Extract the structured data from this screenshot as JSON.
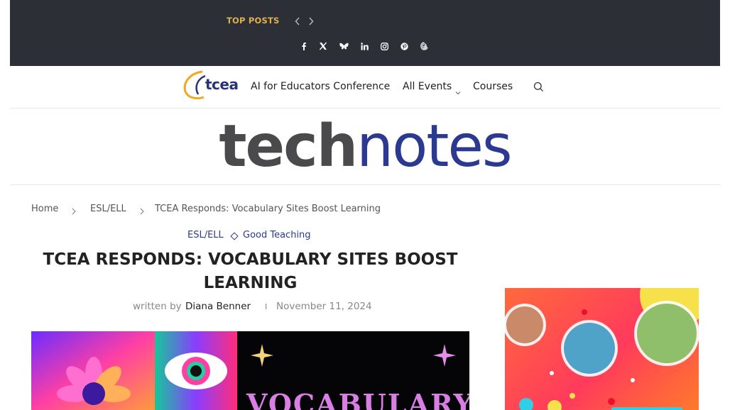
{
  "topbar": {
    "top_posts_label": "TOP POSTS",
    "prev_icon": "chevron-left-icon",
    "next_icon": "chevron-right-icon",
    "social": [
      "facebook-icon",
      "x-icon",
      "bluesky-icon",
      "linkedin-icon",
      "instagram-icon",
      "pinterest-icon",
      "threads-icon"
    ]
  },
  "nav": {
    "logo_text": "tcea",
    "items": [
      "AI for Educators Conference",
      "All Events",
      "Courses"
    ],
    "search_icon": "search-icon"
  },
  "brand": {
    "part1": "tech",
    "part2": "notes"
  },
  "breadcrumb": [
    "Home",
    "ESL/ELL",
    "TCEA Responds: Vocabulary Sites Boost Learning"
  ],
  "article": {
    "categories": [
      "ESL/ELL",
      "Good Teaching"
    ],
    "title": "TCEA RESPONDS: VOCABULARY SITES BOOST LEARNING",
    "byline_prefix": "written by",
    "author": "Diana Benner",
    "separator": "I",
    "date": "November 11, 2024",
    "hero_text": "VOCABULARY"
  },
  "colors": {
    "topbar": "#2c2f35",
    "accent": "#e2b04a",
    "brand_blue": "#2b3990",
    "brand_gray": "#4a4a4c"
  }
}
